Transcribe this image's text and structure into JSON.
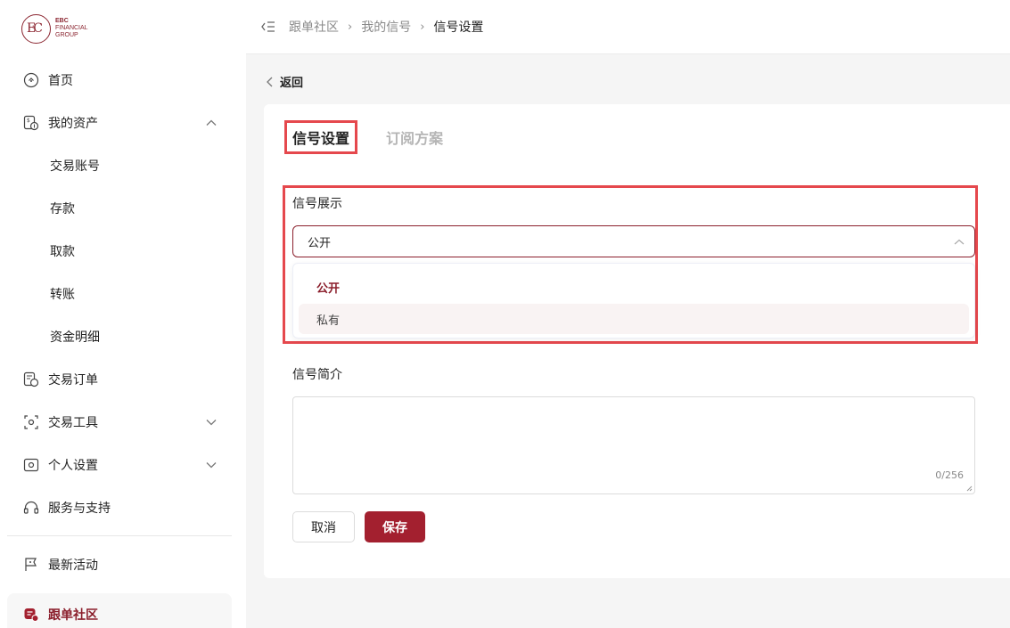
{
  "brand": {
    "line1": "EBC",
    "line2": "FINANCIAL",
    "line3": "GROUP",
    "color": "#8b2530"
  },
  "sidebar": {
    "home": "首页",
    "assets": "我的资产",
    "assets_sub": [
      "交易账号",
      "存款",
      "取款",
      "转账",
      "资金明细"
    ],
    "orders": "交易订单",
    "tools": "交易工具",
    "settings": "个人设置",
    "support": "服务与支持",
    "events": "最新活动",
    "community": "跟单社区"
  },
  "breadcrumb": {
    "item1": "跟单社区",
    "item2": "我的信号",
    "current": "信号设置"
  },
  "back_label": "返回",
  "tabs": {
    "active": "信号设置",
    "inactive": "订阅方案"
  },
  "form": {
    "display_label": "信号展示",
    "display_value": "公开",
    "options": [
      "公开",
      "私有"
    ],
    "intro_label": "信号简介",
    "intro_value": "",
    "counter": "0/256",
    "cancel": "取消",
    "save": "保存"
  },
  "colors": {
    "accent": "#8b1f2c",
    "save_button": "#a3202f",
    "highlight_box": "#e5484d"
  }
}
